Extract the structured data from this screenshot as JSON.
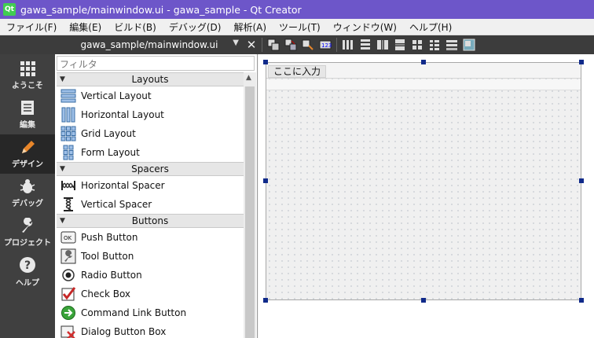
{
  "window": {
    "title": "gawa_sample/mainwindow.ui - gawa_sample - Qt Creator",
    "app_icon_text": "Qt"
  },
  "menubar": {
    "items": [
      "ファイル(F)",
      "編集(E)",
      "ビルド(B)",
      "デバッグ(D)",
      "解析(A)",
      "ツール(T)",
      "ウィンドウ(W)",
      "ヘルプ(H)"
    ]
  },
  "editor_toolbar": {
    "file": "gawa_sample/mainwindow.ui",
    "close": "✕"
  },
  "modes": [
    {
      "label": "ようこそ",
      "icon": "grid-icon",
      "active": false
    },
    {
      "label": "編集",
      "icon": "document-icon",
      "active": false
    },
    {
      "label": "デザイン",
      "icon": "pencil-icon",
      "active": true
    },
    {
      "label": "デバッグ",
      "icon": "bug-icon",
      "active": false
    },
    {
      "label": "プロジェクト",
      "icon": "wrench-icon",
      "active": false
    },
    {
      "label": "ヘルプ",
      "icon": "help-icon",
      "active": false
    }
  ],
  "widget_box": {
    "filter_placeholder": "フィルタ",
    "categories": [
      {
        "name": "Layouts",
        "items": [
          "Vertical Layout",
          "Horizontal Layout",
          "Grid Layout",
          "Form Layout"
        ]
      },
      {
        "name": "Spacers",
        "items": [
          "Horizontal Spacer",
          "Vertical Spacer"
        ]
      },
      {
        "name": "Buttons",
        "items": [
          "Push Button",
          "Tool Button",
          "Radio Button",
          "Check Box",
          "Command Link Button",
          "Dialog Button Box"
        ]
      }
    ]
  },
  "form": {
    "menu_placeholder": "ここに入力"
  },
  "colors": {
    "titlebar": "#6d56c9",
    "sidebar": "#404040",
    "sidebar_active": "#272727",
    "handle": "#102a8a",
    "accent_orange": "#e8862a"
  }
}
